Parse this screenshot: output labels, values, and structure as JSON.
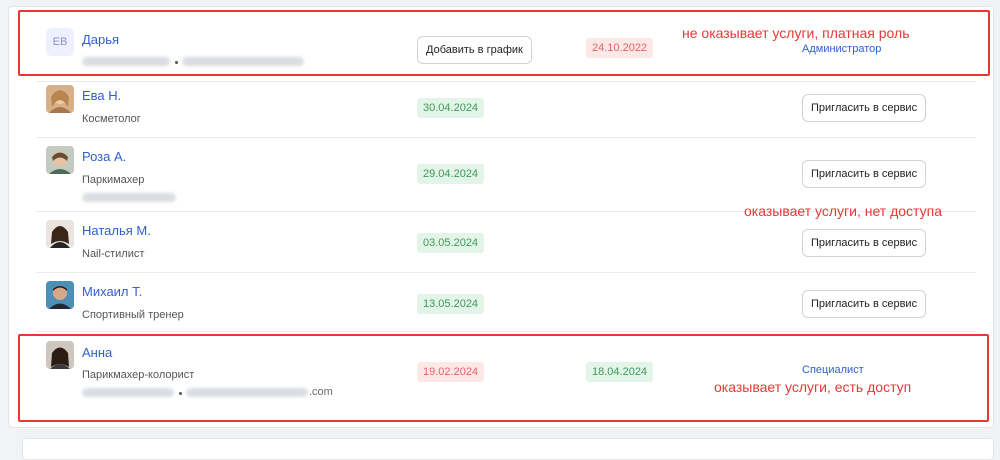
{
  "users": [
    {
      "initials": "ЕВ",
      "name": "Дарья",
      "action_button": "Добавить в график",
      "date_red": "24.10.2022",
      "role_link": "Администратор",
      "annotation": "не оказывает услуги, платная роль"
    },
    {
      "name": "Ева Н.",
      "role": "Косметолог",
      "date_green": "30.04.2024",
      "invite_button": "Пригласить в сервис"
    },
    {
      "name": "Роза А.",
      "role": "Паркимахер",
      "date_green": "29.04.2024",
      "invite_button": "Пригласить в сервис",
      "annotation": "оказывает услуги, нет доступа"
    },
    {
      "name": "Наталья М.",
      "role": "Nail-стилист",
      "date_green": "03.05.2024",
      "invite_button": "Пригласить в сервис"
    },
    {
      "name": "Михаил Т.",
      "role": "Спортивный тренер",
      "date_green": "13.05.2024",
      "invite_button": "Пригласить в сервис"
    },
    {
      "name": "Анна",
      "role": "Парикмахер-колорист",
      "email_suffix": ".com",
      "date_red": "19.02.2024",
      "date_green": "18.04.2024",
      "role_link": "Специалист",
      "annotation": "оказывает услуги, есть доступ"
    }
  ]
}
